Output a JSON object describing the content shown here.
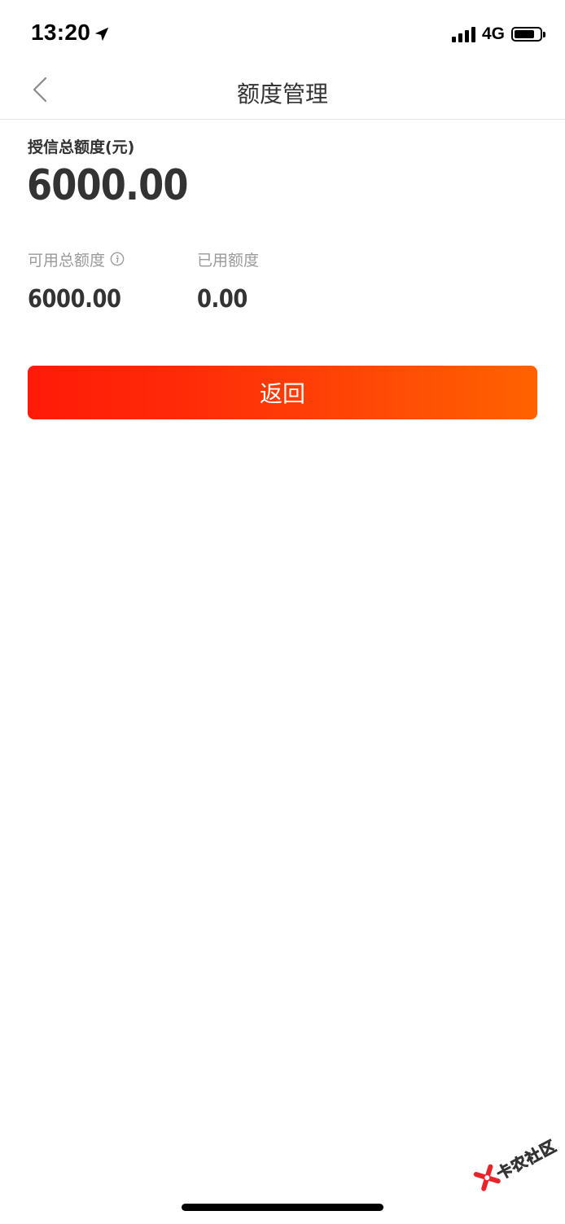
{
  "status_bar": {
    "time": "13:20",
    "network": "4G"
  },
  "nav": {
    "title": "额度管理"
  },
  "credit": {
    "total_label": "授信总额度(元)",
    "total_value": "6000.00",
    "available_label": "可用总额度",
    "available_value": "6000.00",
    "used_label": "已用额度",
    "used_value": "0.00"
  },
  "actions": {
    "return_label": "返回"
  },
  "watermark": {
    "text": "卡农社区"
  },
  "colors": {
    "accent_start": "#ff1a08",
    "accent_end": "#ff6200",
    "text_primary": "#333333",
    "text_secondary": "#9a9a9a"
  },
  "icons": {
    "back": "chevron-left-icon",
    "info": "info-icon",
    "location": "location-arrow-icon"
  }
}
